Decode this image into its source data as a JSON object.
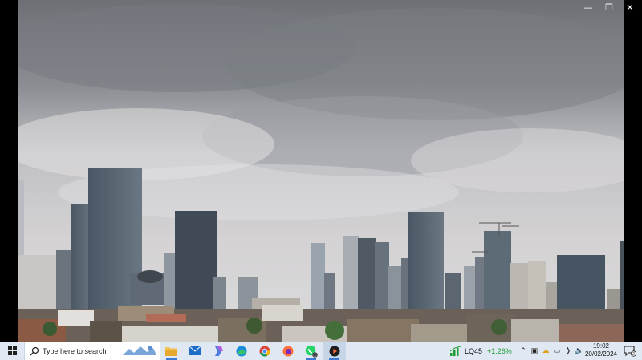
{
  "taskbar": {
    "search_placeholder": "Type here to search",
    "pinned": [
      {
        "name": "File Explorer",
        "icon": "folder-icon"
      },
      {
        "name": "Mail",
        "icon": "mail-icon"
      },
      {
        "name": "Copilot",
        "icon": "copilot-icon"
      },
      {
        "name": "Microsoft Edge",
        "icon": "edge-icon"
      },
      {
        "name": "Google Chrome",
        "icon": "chrome-icon"
      },
      {
        "name": "Firefox",
        "icon": "firefox-icon"
      },
      {
        "name": "WhatsApp",
        "icon": "whatsapp-icon",
        "badge": "1"
      },
      {
        "name": "Media Player",
        "icon": "media-player-icon"
      }
    ],
    "stock": {
      "symbol": "LQ45",
      "change": "+1.26%"
    },
    "clock": {
      "time": "19:02",
      "date": "20/02/2024"
    },
    "notifications_count": "2"
  },
  "colors": {
    "taskbar_bg": "#dfe8f3",
    "accent": "#3b7bd6",
    "stock_up": "#1a9b2e"
  }
}
